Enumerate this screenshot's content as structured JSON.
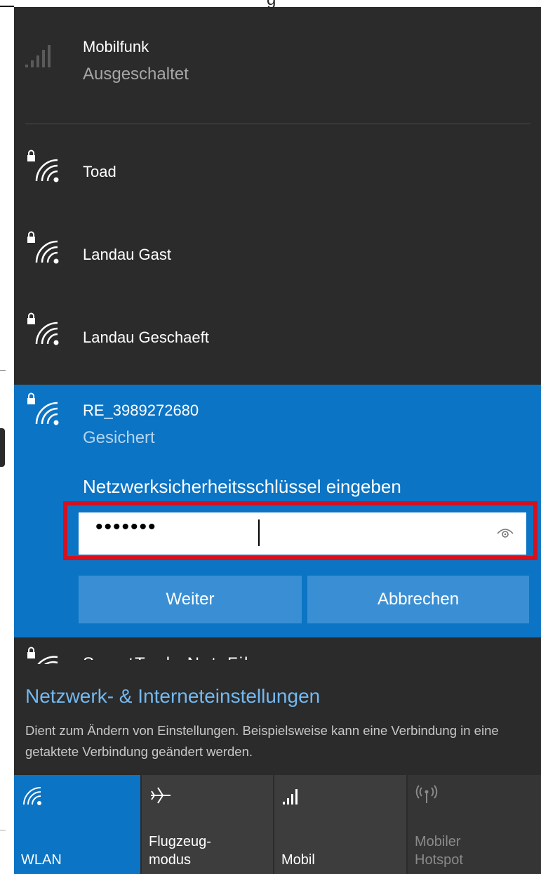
{
  "top_fragment": "g",
  "cellular": {
    "title": "Mobilfunk",
    "status": "Ausgeschaltet",
    "icon": "cellular-signal-icon"
  },
  "networks": [
    {
      "name": "Toad",
      "icon": "secured-wifi-icon"
    },
    {
      "name": "Landau Gast",
      "icon": "secured-wifi-icon"
    },
    {
      "name": "Landau Geschaeft",
      "icon": "secured-wifi-icon"
    }
  ],
  "selected_network": {
    "name": "RE_3989272680",
    "status": "Gesichert",
    "prompt": "Netzwerksicherheitsschlüssel eingeben",
    "password_masked": "•••••••",
    "reveal_icon": "eye-icon",
    "next_label": "Weiter",
    "cancel_label": "Abbrechen",
    "highlight_color": "#d4111e"
  },
  "partial_network": {
    "name": "SmartTools NetzFil",
    "icon": "secured-wifi-icon"
  },
  "settings": {
    "title": "Netzwerk- & Interneteinstellungen",
    "description": "Dient zum Ändern von Einstellungen. Beispielsweise kann eine Verbindung in eine getaktete Verbindung geändert werden."
  },
  "quick_actions": [
    {
      "line1": "",
      "line2": "WLAN",
      "icon": "wifi-icon",
      "state": "on"
    },
    {
      "line1": "Flugzeug-",
      "line2": "modus",
      "icon": "airplane-icon",
      "state": "off"
    },
    {
      "line1": "",
      "line2": "Mobil",
      "icon": "cellular-signal-icon",
      "state": "off"
    },
    {
      "line1": "Mobiler",
      "line2": "Hotspot",
      "icon": "hotspot-icon",
      "state": "disabled"
    }
  ],
  "colors": {
    "panel_bg": "#2b2b2b",
    "accent": "#0c74c4",
    "button_bg": "#3a8fd4",
    "link": "#73b8f0",
    "tile_off": "#3d3d3d",
    "tile_disabled": "#353535"
  }
}
